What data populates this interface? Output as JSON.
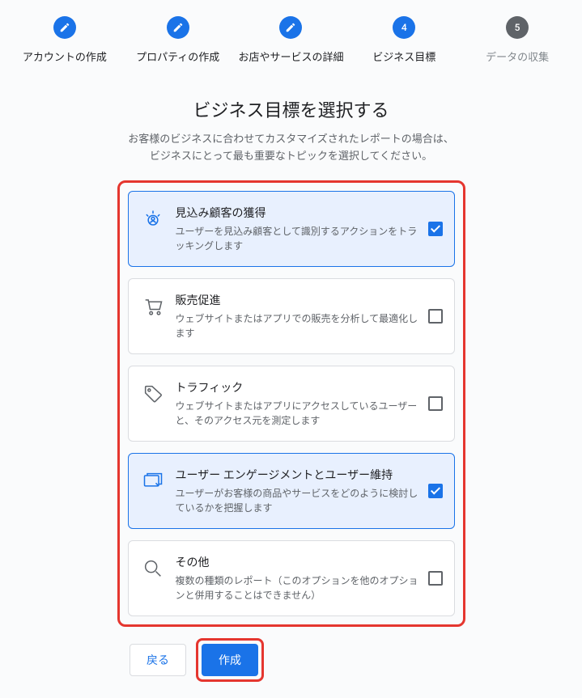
{
  "stepper": {
    "steps": [
      {
        "label": "アカウントの作成",
        "state": "done"
      },
      {
        "label": "プロパティの作成",
        "state": "done"
      },
      {
        "label": "お店やサービスの詳細",
        "state": "done"
      },
      {
        "label": "ビジネス目標",
        "state": "current",
        "num": "4"
      },
      {
        "label": "データの収集",
        "state": "pending",
        "num": "5"
      }
    ]
  },
  "heading": {
    "title": "ビジネス目標を選択する",
    "sub1": "お客様のビジネスに合わせてカスタマイズされたレポートの場合は、",
    "sub2": "ビジネスにとって最も重要なトピックを選択してください。"
  },
  "options": [
    {
      "id": "leads",
      "title": "見込み顧客の獲得",
      "desc": "ユーザーを見込み顧客として識別するアクションをトラッキングします",
      "selected": true
    },
    {
      "id": "sales",
      "title": "販売促進",
      "desc": "ウェブサイトまたはアプリでの販売を分析して最適化します",
      "selected": false
    },
    {
      "id": "traffic",
      "title": "トラフィック",
      "desc": "ウェブサイトまたはアプリにアクセスしているユーザーと、そのアクセス元を測定します",
      "selected": false
    },
    {
      "id": "engagement",
      "title": "ユーザー エンゲージメントとユーザー維持",
      "desc": "ユーザーがお客様の商品やサービスをどのように検討しているかを把握します",
      "selected": true
    },
    {
      "id": "other",
      "title": "その他",
      "desc": "複数の種類のレポート（このオプションを他のオプションと併用することはできません）",
      "selected": false
    }
  ],
  "footer": {
    "back": "戻る",
    "create": "作成"
  }
}
